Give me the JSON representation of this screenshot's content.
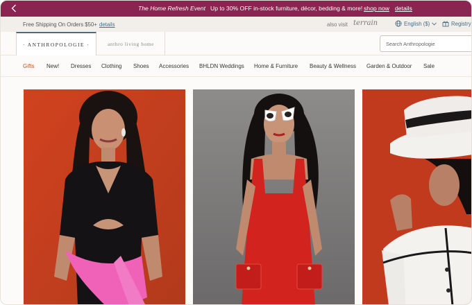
{
  "promo": {
    "event": "The Home Refresh Event",
    "offer": "Up to 30% OFF in-stock furniture, décor, bedding & more!",
    "shop_now": "shop now",
    "details": "details",
    "color": "#8a2450"
  },
  "utility": {
    "shipping": "Free Shipping On Orders $50+",
    "shipping_details": "details",
    "also_visit": "also visit",
    "terrain": "terrain",
    "language": "English ($)",
    "registry": "Registry"
  },
  "brands": {
    "anthropologie": "· ANTHROPOLOGIE ·",
    "home": "anthro living home"
  },
  "search": {
    "placeholder": "Search Anthropologie"
  },
  "nav": {
    "items": [
      "Gifts",
      "New!",
      "Dresses",
      "Clothing",
      "Shoes",
      "Accessories",
      "BHLDN Weddings",
      "Home & Furniture",
      "Beauty & Wellness",
      "Garden & Outdoor",
      "Sale"
    ],
    "active_color": "#c4521e"
  },
  "products": [
    {
      "name": "black cutout dress with pink sweater"
    },
    {
      "name": "red tweed dress with white sunglasses"
    },
    {
      "name": "white jacket with wide-brim hat"
    }
  ]
}
